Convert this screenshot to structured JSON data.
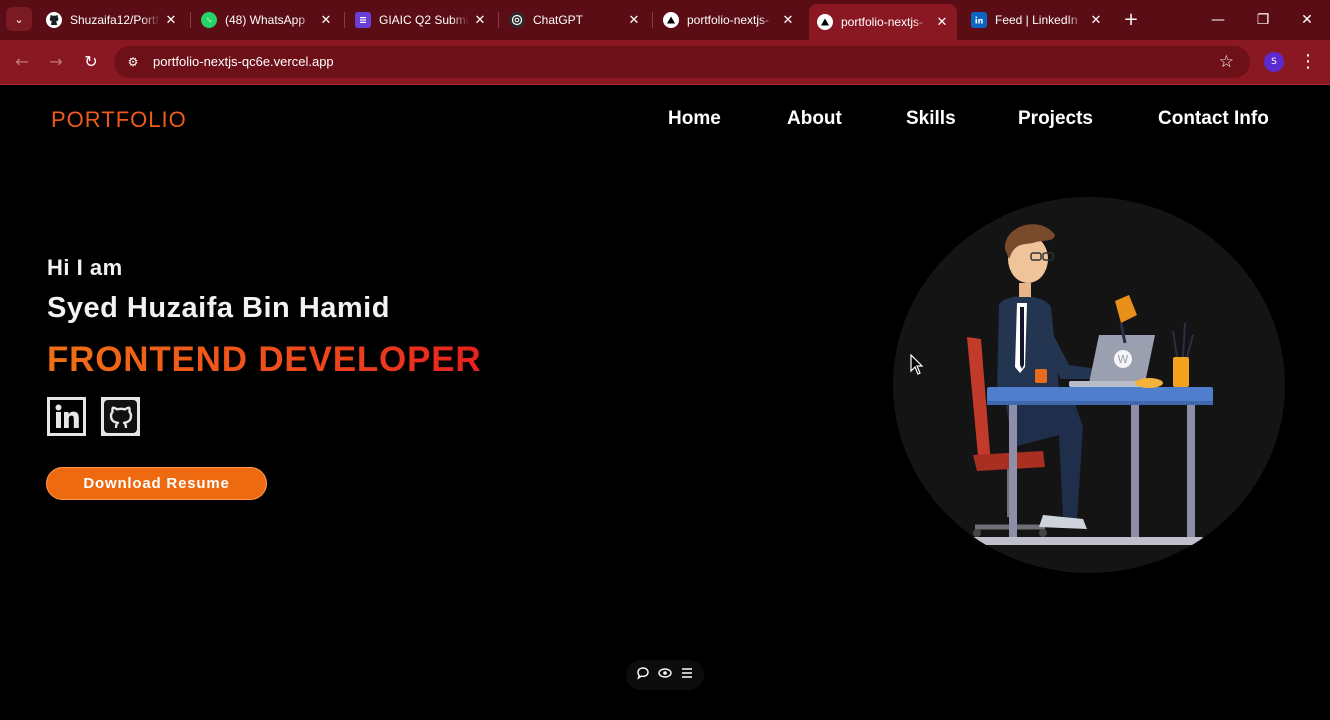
{
  "browser": {
    "tabs": [
      {
        "title": "Shuzaifa12/Portf",
        "icon": "github-icon",
        "active": false
      },
      {
        "title": "(48) WhatsApp",
        "icon": "whatsapp-icon",
        "active": false
      },
      {
        "title": "GIAIC Q2 Submi",
        "icon": "forms-icon",
        "active": false
      },
      {
        "title": "ChatGPT",
        "icon": "chatgpt-icon",
        "active": false
      },
      {
        "title": "portfolio-nextjs-",
        "icon": "vercel-icon",
        "active": false
      },
      {
        "title": "portfolio-nextjs-",
        "icon": "vercel-icon",
        "active": true
      },
      {
        "title": "Feed | LinkedIn",
        "icon": "linkedin-icon",
        "active": false
      }
    ],
    "url": "portfolio-nextjs-qc6e.vercel.app",
    "profile_initial": "S",
    "glyphs": {
      "tab_menu": "⌄",
      "tab_close": "✕",
      "new_tab": "+",
      "minimize": "—",
      "restore": "❐",
      "close_window": "✕",
      "back": "←",
      "forward": "→",
      "reload": "↻",
      "site_info": "⚙",
      "bookmark": "☆",
      "menu": "⋮"
    }
  },
  "page": {
    "logo": "PORTFOLIO",
    "nav": [
      "Home",
      "About",
      "Skills",
      "Projects",
      "Contact Info"
    ],
    "hero": {
      "greeting": "Hi I am",
      "name": "Syed Huzaifa Bin Hamid",
      "role": "FRONTEND DEVELOPER",
      "social": [
        "linkedin-icon",
        "github-icon"
      ],
      "button": "Download Resume",
      "illustration": "developer-at-desk-illustration"
    },
    "toolbar_icons": [
      "comment-icon",
      "eye-icon",
      "list-icon"
    ]
  },
  "colors": {
    "tabbar": "#5a0d14",
    "toolbar": "#8a1822",
    "accent": "#f05a1a",
    "role_gradient_end": "#e8201e",
    "button": "#ee6a10"
  }
}
